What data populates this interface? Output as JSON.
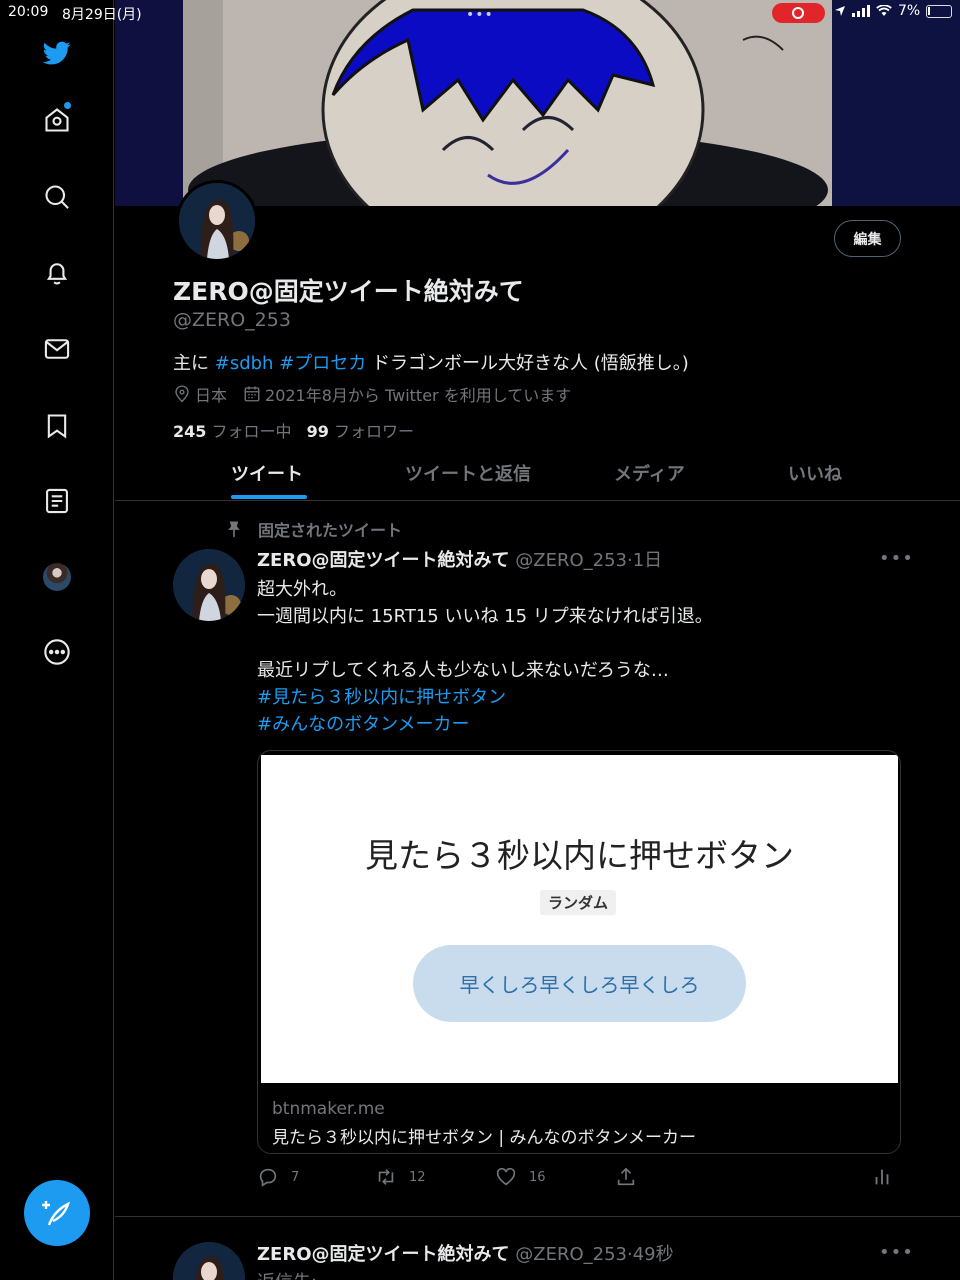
{
  "status_bar": {
    "time": "20:09",
    "date": "8月29日(月)",
    "battery": "7%"
  },
  "nav": {
    "items": [
      "twitter-logo",
      "home",
      "explore",
      "notifications",
      "messages",
      "bookmarks",
      "lists",
      "profile",
      "more"
    ],
    "accent_color": "#1d9bf0"
  },
  "profile": {
    "name": "ZERO@固定ツイート絶対みて",
    "handle": "@ZERO_253",
    "edit_label": "編集",
    "bio_prefix": "主に ",
    "bio_tag1": "#sdbh",
    "bio_tag2": "#プロセカ",
    "bio_suffix": " ドラゴンボール大好きな人 (悟飯推し。)",
    "location": "日本",
    "joined": "2021年8月から Twitter を利用しています",
    "following_count": "245",
    "following_label": "フォロー中",
    "followers_count": "99",
    "followers_label": "フォロワー"
  },
  "tabs": [
    {
      "label": "ツイート",
      "active": true
    },
    {
      "label": "ツイートと返信",
      "active": false
    },
    {
      "label": "メディア",
      "active": false
    },
    {
      "label": "いいね",
      "active": false
    }
  ],
  "pinned_tweet": {
    "pinned_label": "固定されたツイート",
    "name": "ZERO@固定ツイート絶対みて",
    "handle_time": "@ZERO_253·1日",
    "line1": "超大外れ。",
    "line2": "一週間以内に 15RT15 いいね 15 リプ来なければ引退。",
    "line3": "最近リプしてくれる人も少ないし来ないだろうな…",
    "hashtag1": "#見たら３秒以内に押せボタン",
    "hashtag2": "#みんなのボタンメーカー",
    "card": {
      "image_title": "見たら３秒以内に押せボタン",
      "chip": "ランダム",
      "button_text": "早くしろ早くしろ早くしろ",
      "domain": "btnmaker.me",
      "description": "見たら３秒以内に押せボタン | みんなのボタンメーカー"
    },
    "replies": "7",
    "retweets": "12",
    "likes": "16"
  },
  "second_tweet": {
    "name": "ZERO@固定ツイート絶対みて",
    "handle_time": "@ZERO_253·49秒",
    "reply_prefix": "返信先: "
  }
}
